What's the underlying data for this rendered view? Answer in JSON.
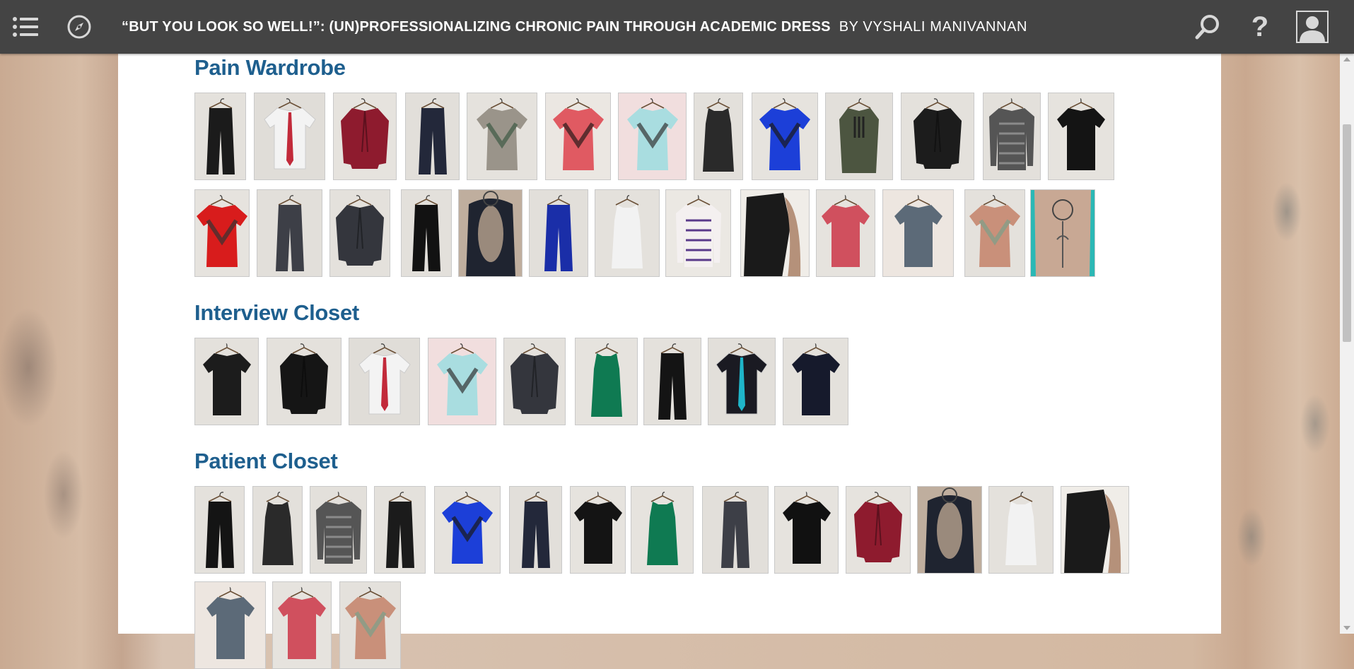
{
  "header": {
    "title": "“BUT YOU LOOK SO WELL!”: (UN)PROFESSIONALIZING CHRONIC PAIN THROUGH ACADEMIC DRESS",
    "byline": "BY VYSHALI MANIVANNAN",
    "icons": [
      "menu-icon",
      "compass-icon",
      "search-icon",
      "help-icon",
      "user-icon"
    ]
  },
  "sections": [
    {
      "title": "Pain Wardrobe",
      "thumbnails": [
        {
          "label": "black flared pants",
          "garment": "pants",
          "color": "#1b1b1b",
          "bg": "#e4e1dc"
        },
        {
          "label": "white shirt with red tie",
          "garment": "shirt-tie",
          "color": "#f3f3f3",
          "accent": "#c22a3a",
          "bg": "#e0ddd8"
        },
        {
          "label": "red blazer",
          "garment": "jacket",
          "color": "#8e1b2e",
          "bg": "#e6e3de"
        },
        {
          "label": "dark jeans",
          "garment": "pants",
          "color": "#23283a",
          "bg": "#e2dfda"
        },
        {
          "label": "green and grey top",
          "garment": "top",
          "color": "#9a948a",
          "accent": "#3d5a45",
          "bg": "#e5e2dd"
        },
        {
          "label": "coral lace top",
          "garment": "top",
          "color": "#e05a62",
          "accent": "#2a1a1a",
          "bg": "#ebe7e2"
        },
        {
          "label": "light blue top",
          "garment": "top",
          "color": "#a9dde0",
          "bg": "#f1dede"
        },
        {
          "label": "black sheer tank",
          "garment": "tank",
          "color": "#2a2a2a",
          "bg": "#e3e0db"
        },
        {
          "label": "blue blouse",
          "garment": "top",
          "color": "#1c3fd8",
          "accent": "#1a1a1a",
          "bg": "#e6e3de"
        },
        {
          "label": "olive dress",
          "garment": "dress",
          "color": "#4c5540",
          "bg": "#e2dfda"
        },
        {
          "label": "black cardigan",
          "garment": "jacket",
          "color": "#1c1c1c",
          "bg": "#e4e1dc"
        },
        {
          "label": "striped grey top",
          "garment": "longsleeve",
          "color": "#555555",
          "accent": "#8a8a8a",
          "bg": "#e3e0db"
        },
        {
          "label": "black t-shirt",
          "garment": "tshirt",
          "color": "#141414",
          "bg": "#e6e3de"
        },
        {
          "label": "red wrap top",
          "garment": "top",
          "color": "#d81c1c",
          "bg": "#e6e3de"
        },
        {
          "label": "grey trousers",
          "garment": "pants",
          "color": "#3d3f47",
          "bg": "#e2dfda"
        },
        {
          "label": "grey blazer",
          "garment": "jacket",
          "color": "#34363d",
          "bg": "#e4e1dc"
        },
        {
          "label": "black leggings",
          "garment": "pants",
          "color": "#121212",
          "bg": "#e3e0db"
        },
        {
          "label": "open back top with tattoo",
          "garment": "back",
          "color": "#1f2430",
          "accent": "#9a8a7c",
          "bg": "#bfae9e"
        },
        {
          "label": "blue pants",
          "garment": "pants",
          "color": "#1a2ea8",
          "bg": "#e2dfda"
        },
        {
          "label": "white sleeveless blouse",
          "garment": "tank",
          "color": "#f2f2f2",
          "bg": "#e4e1dc"
        },
        {
          "label": "geometric print blouse",
          "garment": "longsleeve",
          "color": "#f4f0f0",
          "accent": "#5a3a8a",
          "bg": "#ebe8e3"
        },
        {
          "label": "black tank worn",
          "garment": "worn",
          "color": "#1a1a1a",
          "accent": "#b5917a",
          "bg": "#f0ede8"
        },
        {
          "label": "pink t-shirt",
          "garment": "tshirt",
          "color": "#d0505e",
          "bg": "#e6e3de"
        },
        {
          "label": "queen band t-shirt",
          "garment": "tshirt",
          "color": "#5c6a78",
          "bg": "#ede6e0"
        },
        {
          "label": "plaid top",
          "garment": "top",
          "color": "#c9907a",
          "accent": "#7aa08a",
          "bg": "#e4e1dc"
        },
        {
          "label": "tattooed back",
          "garment": "skin",
          "color": "#c8a894",
          "accent": "#2bb8b5",
          "bg": "#2bb8b5"
        }
      ]
    },
    {
      "title": "Interview Closet",
      "thumbnails": [
        {
          "label": "black short-sleeve blouse",
          "garment": "tshirt",
          "color": "#1c1c1c",
          "bg": "#e4e1dc"
        },
        {
          "label": "black cardigan",
          "garment": "jacket",
          "color": "#151515",
          "bg": "#e4e1dc"
        },
        {
          "label": "white shirt with red tie",
          "garment": "shirt-tie",
          "color": "#f3f3f3",
          "accent": "#c22a3a",
          "bg": "#e0ddd8"
        },
        {
          "label": "light blue top",
          "garment": "top",
          "color": "#a9dde0",
          "bg": "#f1dede"
        },
        {
          "label": "grey blazer",
          "garment": "jacket",
          "color": "#34363d",
          "bg": "#e4e1dc"
        },
        {
          "label": "green satin blouse",
          "garment": "tank",
          "color": "#0f7a52",
          "bg": "#e6e3de"
        },
        {
          "label": "black trousers",
          "garment": "pants",
          "color": "#141414",
          "bg": "#e4e1dc"
        },
        {
          "label": "black shirt with teal pink tie",
          "garment": "shirt-tie",
          "color": "#1a1a22",
          "accent": "#1fb5c9",
          "bg": "#e2dfda"
        },
        {
          "label": "navy shirt",
          "garment": "tshirt",
          "color": "#161a2c",
          "bg": "#e4e1dc"
        }
      ]
    },
    {
      "title": "Patient Closet",
      "thumbnails": [
        {
          "label": "black leggings",
          "garment": "pants",
          "color": "#141414",
          "bg": "#e4e1dc"
        },
        {
          "label": "black sheer tank",
          "garment": "tank",
          "color": "#2a2a2a",
          "bg": "#e3e0db"
        },
        {
          "label": "striped grey top",
          "garment": "longsleeve",
          "color": "#555555",
          "accent": "#8a8a8a",
          "bg": "#e3e0db"
        },
        {
          "label": "black flared pants",
          "garment": "pants",
          "color": "#1b1b1b",
          "bg": "#e4e1dc"
        },
        {
          "label": "blue blouse",
          "garment": "top",
          "color": "#1c3fd8",
          "accent": "#1a1a1a",
          "bg": "#e6e3de"
        },
        {
          "label": "dark jeans",
          "garment": "pants",
          "color": "#23283a",
          "bg": "#e2dfda"
        },
        {
          "label": "black t-shirt",
          "garment": "tshirt",
          "color": "#141414",
          "bg": "#e6e3de"
        },
        {
          "label": "green satin blouse",
          "garment": "tank",
          "color": "#0f7a52",
          "bg": "#e6e3de"
        },
        {
          "label": "grey trousers",
          "garment": "pants",
          "color": "#3d3f47",
          "bg": "#e2dfda"
        },
        {
          "label": "black tee",
          "garment": "tshirt",
          "color": "#111111",
          "bg": "#e6e3de"
        },
        {
          "label": "red blazer",
          "garment": "jacket",
          "color": "#8e1b2e",
          "bg": "#e6e3de"
        },
        {
          "label": "open back top with tattoo",
          "garment": "back",
          "color": "#1f2430",
          "accent": "#9a8a7c",
          "bg": "#bfae9e"
        },
        {
          "label": "white sleeveless blouse",
          "garment": "tank",
          "color": "#f2f2f2",
          "bg": "#e4e1dc"
        },
        {
          "label": "black tank worn",
          "garment": "worn",
          "color": "#1a1a1a",
          "accent": "#b5917a",
          "bg": "#f0ede8"
        },
        {
          "label": "queen band t-shirt",
          "garment": "tshirt",
          "color": "#5c6a78",
          "bg": "#ede6e0"
        },
        {
          "label": "pink t-shirt",
          "garment": "tshirt",
          "color": "#d0505e",
          "bg": "#e6e3de"
        },
        {
          "label": "plaid top",
          "garment": "top",
          "color": "#c9907a",
          "accent": "#7aa08a",
          "bg": "#e4e1dc"
        }
      ]
    }
  ],
  "colors": {
    "header_bg": "#444444",
    "section_title": "#1e5f8e",
    "panel_bg": "#ffffff"
  }
}
